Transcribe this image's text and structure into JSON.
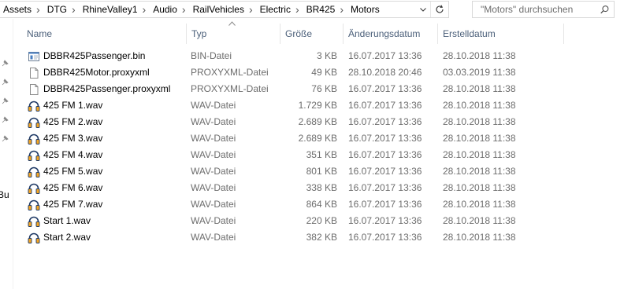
{
  "breadcrumb": [
    "Assets",
    "DTG",
    "RhineValley1",
    "Audio",
    "RailVehicles",
    "Electric",
    "BR425",
    "Motors"
  ],
  "search": {
    "placeholder": "\"Motors\" durchsuchen"
  },
  "nav_pane": {
    "partial_text": "Bu"
  },
  "columns": {
    "name": "Name",
    "type": "Typ",
    "size": "Größe",
    "modified": "Änderungsdatum",
    "created": "Erstelldatum"
  },
  "files": [
    {
      "name": "DBBR425Passenger.bin",
      "type": "BIN-Datei",
      "size": "3 KB",
      "modified": "16.07.2017 13:36",
      "created": "28.10.2018 11:38",
      "icon": "bin-file-icon"
    },
    {
      "name": "DBBR425Motor.proxyxml",
      "type": "PROXYXML-Datei",
      "size": "49 KB",
      "modified": "28.10.2018 20:46",
      "created": "03.03.2019 11:38",
      "icon": "document-file-icon"
    },
    {
      "name": "DBBR425Passenger.proxyxml",
      "type": "PROXYXML-Datei",
      "size": "76 KB",
      "modified": "16.07.2017 13:36",
      "created": "28.10.2018 11:38",
      "icon": "document-file-icon"
    },
    {
      "name": "425 FM 1.wav",
      "type": "WAV-Datei",
      "size": "1.729 KB",
      "modified": "16.07.2017 13:36",
      "created": "28.10.2018 11:38",
      "icon": "headphones-audio-icon"
    },
    {
      "name": "425 FM 2.wav",
      "type": "WAV-Datei",
      "size": "2.689 KB",
      "modified": "16.07.2017 13:36",
      "created": "28.10.2018 11:38",
      "icon": "headphones-audio-icon"
    },
    {
      "name": "425 FM 3.wav",
      "type": "WAV-Datei",
      "size": "2.689 KB",
      "modified": "16.07.2017 13:36",
      "created": "28.10.2018 11:38",
      "icon": "headphones-audio-icon"
    },
    {
      "name": "425 FM 4.wav",
      "type": "WAV-Datei",
      "size": "351 KB",
      "modified": "16.07.2017 13:36",
      "created": "28.10.2018 11:38",
      "icon": "headphones-audio-icon"
    },
    {
      "name": "425 FM 5.wav",
      "type": "WAV-Datei",
      "size": "801 KB",
      "modified": "16.07.2017 13:36",
      "created": "28.10.2018 11:38",
      "icon": "headphones-audio-icon"
    },
    {
      "name": "425 FM 6.wav",
      "type": "WAV-Datei",
      "size": "338 KB",
      "modified": "16.07.2017 13:36",
      "created": "28.10.2018 11:38",
      "icon": "headphones-audio-icon"
    },
    {
      "name": "425 FM 7.wav",
      "type": "WAV-Datei",
      "size": "864 KB",
      "modified": "16.07.2017 13:36",
      "created": "28.10.2018 11:38",
      "icon": "headphones-audio-icon"
    },
    {
      "name": "Start 1.wav",
      "type": "WAV-Datei",
      "size": "220 KB",
      "modified": "16.07.2017 13:36",
      "created": "28.10.2018 11:38",
      "icon": "headphones-audio-icon"
    },
    {
      "name": "Start 2.wav",
      "type": "WAV-Datei",
      "size": "382 KB",
      "modified": "16.07.2017 13:36",
      "created": "28.10.2018 11:38",
      "icon": "headphones-audio-icon"
    }
  ],
  "colors": {
    "header_text": "#4c607a",
    "secondary_text": "#6d6d6d",
    "audio_icon_orange": "#f5a623"
  }
}
